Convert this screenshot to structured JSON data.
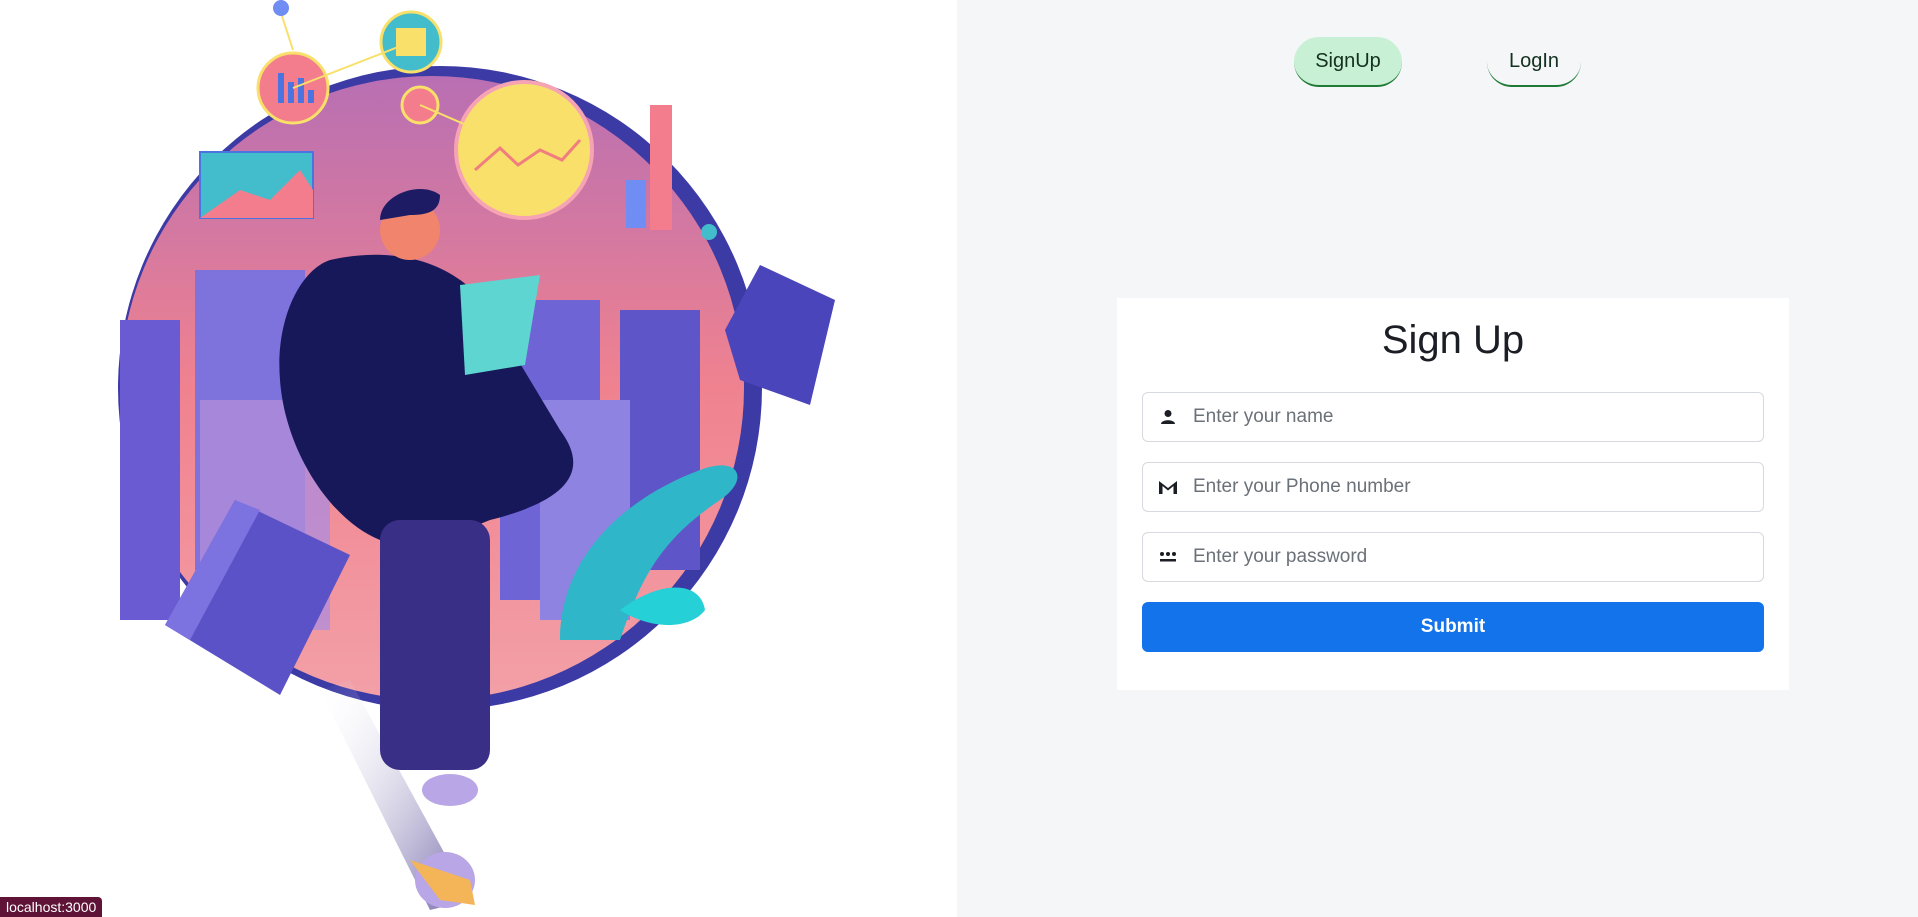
{
  "nav": {
    "signup_label": "SignUp",
    "login_label": "LogIn"
  },
  "form": {
    "title": "Sign Up",
    "name_placeholder": "Enter your name",
    "phone_placeholder": "Enter your Phone number",
    "password_placeholder": "Enter your password",
    "submit_label": "Submit"
  },
  "icons": {
    "name": "person-icon",
    "phone": "gmail-m-icon",
    "password": "password-dots-icon"
  },
  "status_bar": {
    "url": "localhost:3000"
  },
  "colors": {
    "primary": "#1273ea",
    "signup_tab_bg": "#c8f0d4",
    "tab_underline": "#1f7a35",
    "right_pane_bg": "#f5f6f8",
    "status_chip_bg": "#5e1337"
  }
}
